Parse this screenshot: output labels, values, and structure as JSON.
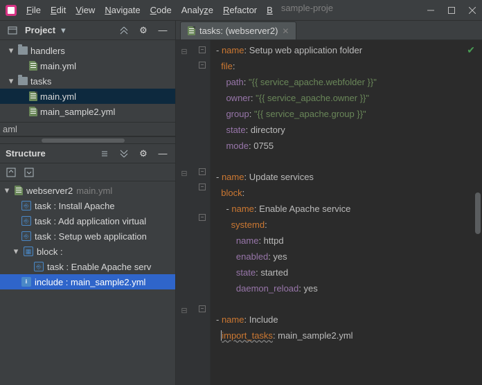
{
  "titlebar": {
    "menu": [
      "File",
      "Edit",
      "View",
      "Navigate",
      "Code",
      "Analyze",
      "Refactor",
      "B"
    ],
    "project_name": "sample-proje"
  },
  "project_panel": {
    "title": "Project",
    "tree": {
      "handlers": "handlers",
      "handlers_main": "main.yml",
      "tasks": "tasks",
      "tasks_main": "main.yml",
      "tasks_sample": "main_sample2.yml"
    },
    "aml": "aml"
  },
  "structure_panel": {
    "title": "Structure",
    "root": "webserver2",
    "root_file": "main.yml",
    "items": [
      "task : Install Apache",
      "task : Add application virtual",
      "task : Setup web application",
      "block :",
      "task : Enable Apache serv",
      "include : main_sample2.yml"
    ]
  },
  "editor": {
    "tab_label": "tasks: (webserver2)",
    "lines": [
      {
        "t": "- ",
        "k": "name",
        "c": ": ",
        "v": "Setup web application folder",
        "vc": "p"
      },
      {
        "t": "  ",
        "k": "file",
        "c": ":",
        "v": "",
        "vc": ""
      },
      {
        "t": "    ",
        "k": "path",
        "c": ": ",
        "v": "\"{{ service_apache.webfolder }}\"",
        "vc": "s"
      },
      {
        "t": "    ",
        "k": "owner",
        "c": ": ",
        "v": "\"{{ service_apache.owner }}\"",
        "vc": "s"
      },
      {
        "t": "    ",
        "k": "group",
        "c": ": ",
        "v": "\"{{ service_apache.group }}\"",
        "vc": "s"
      },
      {
        "t": "    ",
        "k": "state",
        "c": ": ",
        "v": "directory",
        "vc": "p"
      },
      {
        "t": "    ",
        "k": "mode",
        "c": ": ",
        "v": "0755",
        "vc": "p"
      },
      {
        "blank": true
      },
      {
        "t": "- ",
        "k": "name",
        "c": ": ",
        "v": "Update services",
        "vc": "p"
      },
      {
        "t": "  ",
        "k": "block",
        "c": ":",
        "v": "",
        "vc": ""
      },
      {
        "t": "    - ",
        "k": "name",
        "c": ": ",
        "v": "Enable Apache service",
        "vc": "p"
      },
      {
        "t": "      ",
        "k": "systemd",
        "c": ":",
        "v": "",
        "vc": "",
        "bold": true
      },
      {
        "t": "        ",
        "k": "name",
        "c": ": ",
        "v": "httpd",
        "vc": "p"
      },
      {
        "t": "        ",
        "k": "enabled",
        "c": ": ",
        "v": "yes",
        "vc": "p"
      },
      {
        "t": "        ",
        "k": "state",
        "c": ": ",
        "v": "started",
        "vc": "p"
      },
      {
        "t": "        ",
        "k": "daemon_reload",
        "c": ": ",
        "v": "yes",
        "vc": "p"
      },
      {
        "blank": true
      },
      {
        "t": "- ",
        "k": "name",
        "c": ": ",
        "v": "Include",
        "vc": "p"
      },
      {
        "t": "  ",
        "k": "import_tasks",
        "c": ": ",
        "v": "main_sample2.yml",
        "vc": "p",
        "ul": true
      }
    ]
  }
}
